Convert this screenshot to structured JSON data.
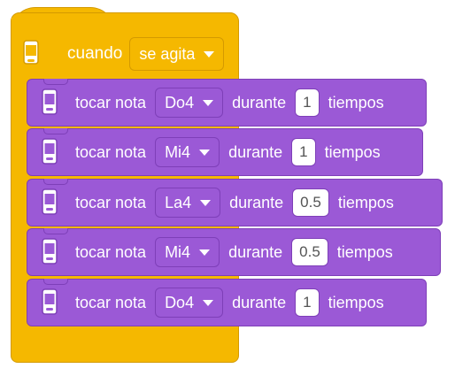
{
  "hat": {
    "label": "cuando",
    "event": "se agita",
    "icon": "device-icon"
  },
  "blocks": [
    {
      "action": "tocar nota",
      "note": "Do4",
      "during": "durante",
      "beats": "1",
      "unit": "tiempos"
    },
    {
      "action": "tocar nota",
      "note": "Mi4",
      "during": "durante",
      "beats": "1",
      "unit": "tiempos"
    },
    {
      "action": "tocar nota",
      "note": "La4",
      "during": "durante",
      "beats": "0.5",
      "unit": "tiempos"
    },
    {
      "action": "tocar nota",
      "note": "Mi4",
      "during": "durante",
      "beats": "0.5",
      "unit": "tiempos"
    },
    {
      "action": "tocar nota",
      "note": "Do4",
      "during": "durante",
      "beats": "1",
      "unit": "tiempos"
    }
  ],
  "colors": {
    "event_block": "#f5b800",
    "sound_block": "#9b59d6",
    "text": "#ffffff"
  }
}
